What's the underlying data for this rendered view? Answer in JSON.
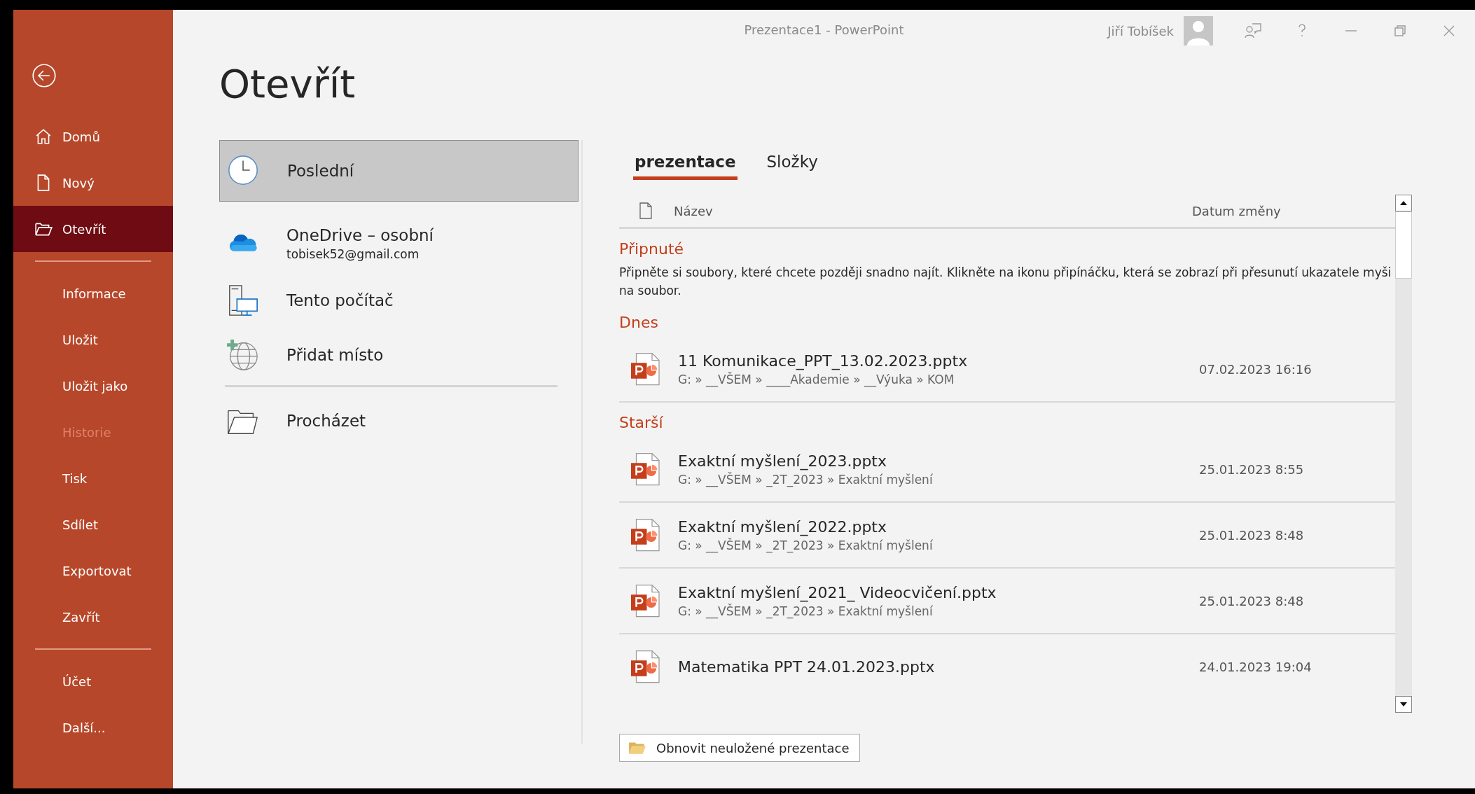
{
  "window": {
    "title": "Prezentace1  -  PowerPoint",
    "user": "Jiří Tobíšek"
  },
  "sidebar": {
    "items": [
      {
        "kind": "home",
        "label": "Domů",
        "selected": false,
        "disabled": false
      },
      {
        "kind": "new",
        "label": "Nový",
        "selected": false,
        "disabled": false
      },
      {
        "kind": "open",
        "label": "Otevřít",
        "selected": true,
        "disabled": false
      },
      {
        "kind": "divider"
      },
      {
        "kind": "plain",
        "label": "Informace",
        "selected": false,
        "disabled": false
      },
      {
        "kind": "plain",
        "label": "Uložit",
        "selected": false,
        "disabled": false
      },
      {
        "kind": "plain",
        "label": "Uložit jako",
        "selected": false,
        "disabled": false
      },
      {
        "kind": "plain",
        "label": "Historie",
        "selected": false,
        "disabled": true
      },
      {
        "kind": "plain",
        "label": "Tisk",
        "selected": false,
        "disabled": false
      },
      {
        "kind": "plain",
        "label": "Sdílet",
        "selected": false,
        "disabled": false
      },
      {
        "kind": "plain",
        "label": "Exportovat",
        "selected": false,
        "disabled": false
      },
      {
        "kind": "plain",
        "label": "Zavřít",
        "selected": false,
        "disabled": false
      },
      {
        "kind": "divider"
      },
      {
        "kind": "plain",
        "label": "Účet",
        "selected": false,
        "disabled": false
      },
      {
        "kind": "plain",
        "label": "Další...",
        "selected": false,
        "disabled": false
      }
    ]
  },
  "page_title": "Otevřít",
  "locations": [
    {
      "kind": "recent",
      "label": "Poslední",
      "selected": true
    },
    {
      "kind": "onedrive",
      "label": "OneDrive – osobní",
      "sublabel": "tobisek52@gmail.com",
      "selected": false
    },
    {
      "kind": "computer",
      "label": "Tento počítač",
      "selected": false
    },
    {
      "kind": "add_place",
      "label": "Přidat místo",
      "selected": false
    },
    {
      "kind": "divider"
    },
    {
      "kind": "browse",
      "label": "Procházet",
      "selected": false
    }
  ],
  "tabs": [
    {
      "label": "prezentace",
      "selected": true
    },
    {
      "label": "Složky",
      "selected": false
    }
  ],
  "file_list": {
    "columns": [
      "Název",
      "Datum změny"
    ],
    "groups": [
      {
        "title": "Připnuté",
        "description": "Připněte si soubory, které chcete později snadno najít. Klikněte na ikonu připínáčku, která se zobrazí při přesunutí ukazatele myši na soubor."
      },
      {
        "title": "Dnes",
        "files": [
          {
            "name": "11 Komunikace_PPT_13.02.2023.pptx",
            "path": "G: » __VŠEM » ____Akademie » __Výuka » KOM",
            "date": "07.02.2023 16:16"
          }
        ]
      },
      {
        "title": "Starší",
        "files": [
          {
            "name": "Exaktní myšlení_2023.pptx",
            "path": "G: » __VŠEM » _2T_2023 » Exaktní myšlení",
            "date": "25.01.2023 8:55"
          },
          {
            "name": "Exaktní myšlení_2022.pptx",
            "path": "G: » __VŠEM » _2T_2023 » Exaktní myšlení",
            "date": "25.01.2023 8:48"
          },
          {
            "name": "Exaktní myšlení_2021_ Videocvičení.pptx",
            "path": "G: » __VŠEM » _2T_2023 » Exaktní myšlení",
            "date": "25.01.2023 8:48"
          },
          {
            "name": "Matematika PPT 24.01.2023.pptx",
            "date": "24.01.2023 19:04"
          }
        ]
      }
    ]
  },
  "recover_button": "Obnovit neuložené prezentace"
}
